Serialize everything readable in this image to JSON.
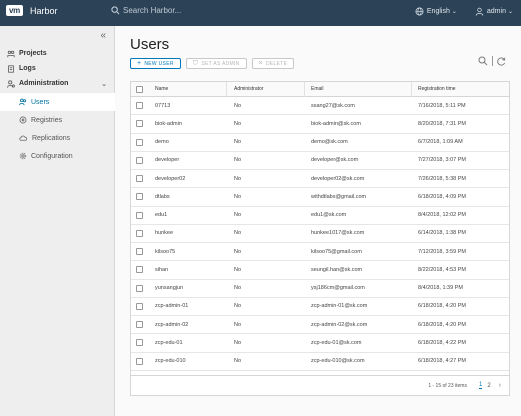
{
  "header": {
    "logo": "vm",
    "app_title": "Harbor",
    "search_placeholder": "Search Harbor...",
    "language": "English",
    "user": "admin"
  },
  "sidebar": {
    "collapse_label": "«",
    "items": [
      {
        "label": "Projects",
        "icon": "projects-icon"
      },
      {
        "label": "Logs",
        "icon": "logs-icon"
      },
      {
        "label": "Administration",
        "icon": "administration-icon"
      }
    ],
    "admin_items": [
      {
        "label": "Users",
        "icon": "users-icon",
        "active": true
      },
      {
        "label": "Registries",
        "icon": "registries-icon"
      },
      {
        "label": "Replications",
        "icon": "replications-icon"
      },
      {
        "label": "Configuration",
        "icon": "configuration-icon"
      }
    ]
  },
  "main": {
    "title": "Users",
    "buttons": {
      "new_user": "NEW USER",
      "set_as_admin": "SET AS ADMIN",
      "delete": "DELETE"
    },
    "columns": [
      "Name",
      "Administrator",
      "Email",
      "Registration time"
    ],
    "rows": [
      {
        "name": "07713",
        "admin": "No",
        "email": "ssang27@sk.com",
        "time": "7/16/2018, 5:11 PM"
      },
      {
        "name": "biok-admin",
        "admin": "No",
        "email": "biok-admin@sk.com",
        "time": "8/20/2018, 7:31 PM"
      },
      {
        "name": "demo",
        "admin": "No",
        "email": "demo@sk.com",
        "time": "6/7/2018, 1:09 AM"
      },
      {
        "name": "developer",
        "admin": "No",
        "email": "developer@sk.com",
        "time": "7/27/2018, 3:07 PM"
      },
      {
        "name": "developer02",
        "admin": "No",
        "email": "developer02@sk.com",
        "time": "7/26/2018, 5:38 PM"
      },
      {
        "name": "dtlabs",
        "admin": "No",
        "email": "withdtlabs@gmail.com",
        "time": "6/18/2018, 4:09 PM"
      },
      {
        "name": "edu1",
        "admin": "No",
        "email": "edu1@sk.com",
        "time": "8/4/2018, 12:02 PM"
      },
      {
        "name": "hunkee",
        "admin": "No",
        "email": "hunkee1017@sk.com",
        "time": "6/14/2018, 1:38 PM"
      },
      {
        "name": "kilsoo75",
        "admin": "No",
        "email": "kilsoo75@gmail.com",
        "time": "7/12/2018, 3:59 PM"
      },
      {
        "name": "sihan",
        "admin": "No",
        "email": "seungil.han@sk.com",
        "time": "8/22/2018, 4:53 PM"
      },
      {
        "name": "yunsangjun",
        "admin": "No",
        "email": "ysj186cm@gmail.com",
        "time": "8/4/2018, 1:39 PM"
      },
      {
        "name": "zcp-admin-01",
        "admin": "No",
        "email": "zcp-admin-01@sk.com",
        "time": "6/18/2018, 4:20 PM"
      },
      {
        "name": "zcp-admin-02",
        "admin": "No",
        "email": "zcp-admin-02@sk.com",
        "time": "6/18/2018, 4:20 PM"
      },
      {
        "name": "zcp-edu-01",
        "admin": "No",
        "email": "zcp-edu-01@sk.com",
        "time": "6/18/2018, 4:22 PM"
      },
      {
        "name": "zcp-edu-010",
        "admin": "No",
        "email": "zcp-edu-010@sk.com",
        "time": "6/18/2018, 4:27 PM"
      }
    ],
    "footer": {
      "summary": "1 - 15 of 23 items",
      "pages": [
        "1",
        "2"
      ],
      "next": "›"
    }
  }
}
